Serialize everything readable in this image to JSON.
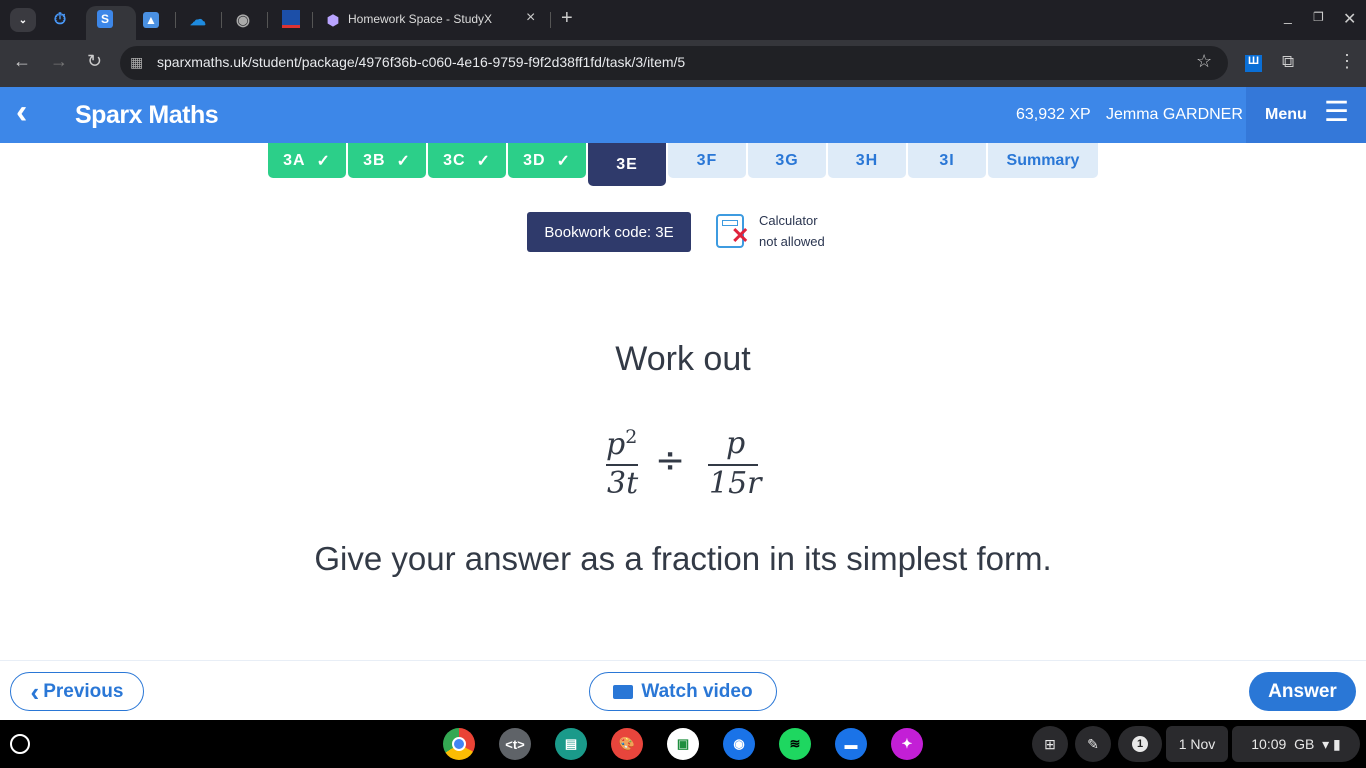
{
  "browser": {
    "tab_title": "Homework Space - StudyX",
    "url": "sparxmaths.uk/student/package/4976f36b-c060-4e16-9759-f9f2d38ff1fd/task/3/item/5",
    "close": "×",
    "new_tab": "+"
  },
  "header": {
    "title": "Sparx Maths",
    "xp": "63,932 XP",
    "user": "Jemma GARDNER",
    "menu": "Menu"
  },
  "tasks": [
    {
      "label": "3A",
      "status": "done"
    },
    {
      "label": "3B",
      "status": "done"
    },
    {
      "label": "3C",
      "status": "done"
    },
    {
      "label": "3D",
      "status": "done"
    },
    {
      "label": "3E",
      "status": "current"
    },
    {
      "label": "3F",
      "status": "todo"
    },
    {
      "label": "3G",
      "status": "todo"
    },
    {
      "label": "3H",
      "status": "todo"
    },
    {
      "label": "3I",
      "status": "todo"
    },
    {
      "label": "Summary",
      "status": "todo"
    }
  ],
  "bookwork": "Bookwork code: 3E",
  "calculator": {
    "line1": "Calculator",
    "line2": "not allowed"
  },
  "question": {
    "intro": "Work out",
    "frac1_num": "p",
    "frac1_exp": "2",
    "frac1_den": "3t",
    "op": "÷",
    "frac2_num": "p",
    "frac2_den": "15r",
    "instruction": "Give your answer as a fraction in its simplest form."
  },
  "footer": {
    "previous": "Previous",
    "watch": "Watch video",
    "answer": "Answer"
  },
  "shelf": {
    "date": "1 Nov",
    "time": "10:09",
    "locale": "GB",
    "notifications": "1"
  },
  "colors": {
    "brand": "#3d87e8",
    "done": "#2ccf89",
    "current": "#2f3a6b",
    "todo": "#deebf8"
  }
}
